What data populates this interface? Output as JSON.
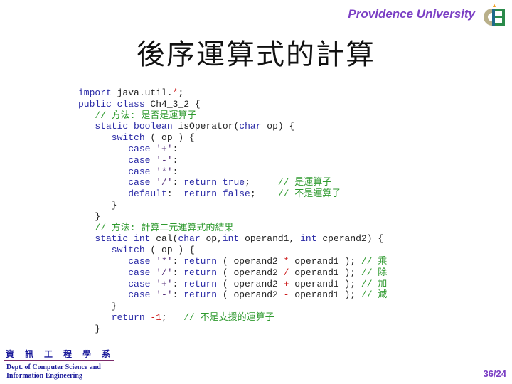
{
  "header": {
    "brand": "Providence University",
    "logo_icon": "ce-logo-icon"
  },
  "slide": {
    "title": "後序運算式的計算"
  },
  "code": {
    "lines": [
      [
        {
          "t": "import ",
          "c": "kw"
        },
        {
          "t": "java.util.",
          "c": ""
        },
        {
          "t": "*",
          "c": "op"
        },
        {
          "t": ";",
          "c": ""
        }
      ],
      [
        {
          "t": "public class ",
          "c": "kw"
        },
        {
          "t": "Ch4_3_2 {",
          "c": ""
        }
      ],
      [
        {
          "t": "   // 方法: 是否是運算子",
          "c": "cm"
        }
      ],
      [
        {
          "t": "   static boolean ",
          "c": "kw"
        },
        {
          "t": "isOperator(",
          "c": ""
        },
        {
          "t": "char ",
          "c": "kw"
        },
        {
          "t": "op) {",
          "c": ""
        }
      ],
      [
        {
          "t": "      switch ",
          "c": "kw"
        },
        {
          "t": "( op ) {",
          "c": ""
        }
      ],
      [
        {
          "t": "         case ",
          "c": "kw"
        },
        {
          "t": "'+'",
          "c": "str"
        },
        {
          "t": ":",
          "c": ""
        }
      ],
      [
        {
          "t": "         case ",
          "c": "kw"
        },
        {
          "t": "'-'",
          "c": "str"
        },
        {
          "t": ":",
          "c": ""
        }
      ],
      [
        {
          "t": "         case ",
          "c": "kw"
        },
        {
          "t": "'*'",
          "c": "str"
        },
        {
          "t": ":",
          "c": ""
        }
      ],
      [
        {
          "t": "         case ",
          "c": "kw"
        },
        {
          "t": "'/'",
          "c": "str"
        },
        {
          "t": ": ",
          "c": ""
        },
        {
          "t": "return true",
          "c": "kw"
        },
        {
          "t": ";     ",
          "c": ""
        },
        {
          "t": "// 是運算子",
          "c": "cm"
        }
      ],
      [
        {
          "t": "         default",
          "c": "kw"
        },
        {
          "t": ":  ",
          "c": ""
        },
        {
          "t": "return false",
          "c": "kw"
        },
        {
          "t": ";    ",
          "c": ""
        },
        {
          "t": "// 不是運算子",
          "c": "cm"
        }
      ],
      [
        {
          "t": "      }",
          "c": ""
        }
      ],
      [
        {
          "t": "   }",
          "c": ""
        }
      ],
      [
        {
          "t": "   // 方法: 計算二元運算式的結果",
          "c": "cm"
        }
      ],
      [
        {
          "t": "   static int ",
          "c": "kw"
        },
        {
          "t": "cal(",
          "c": ""
        },
        {
          "t": "char ",
          "c": "kw"
        },
        {
          "t": "op,",
          "c": ""
        },
        {
          "t": "int ",
          "c": "kw"
        },
        {
          "t": "operand1, ",
          "c": ""
        },
        {
          "t": "int ",
          "c": "kw"
        },
        {
          "t": "cperand2) {",
          "c": ""
        }
      ],
      [
        {
          "t": "      switch ",
          "c": "kw"
        },
        {
          "t": "( op ) {",
          "c": ""
        }
      ],
      [
        {
          "t": "         case ",
          "c": "kw"
        },
        {
          "t": "'*'",
          "c": "str"
        },
        {
          "t": ": ",
          "c": ""
        },
        {
          "t": "return ",
          "c": "kw"
        },
        {
          "t": "( operand2 ",
          "c": ""
        },
        {
          "t": "*",
          "c": "op"
        },
        {
          "t": " operand1 ); ",
          "c": ""
        },
        {
          "t": "// 乘",
          "c": "cm"
        }
      ],
      [
        {
          "t": "         case ",
          "c": "kw"
        },
        {
          "t": "'/'",
          "c": "str"
        },
        {
          "t": ": ",
          "c": ""
        },
        {
          "t": "return ",
          "c": "kw"
        },
        {
          "t": "( operand2 ",
          "c": ""
        },
        {
          "t": "/",
          "c": "op"
        },
        {
          "t": " operand1 ); ",
          "c": ""
        },
        {
          "t": "// 除",
          "c": "cm"
        }
      ],
      [
        {
          "t": "         case ",
          "c": "kw"
        },
        {
          "t": "'+'",
          "c": "str"
        },
        {
          "t": ": ",
          "c": ""
        },
        {
          "t": "return ",
          "c": "kw"
        },
        {
          "t": "( operand2 ",
          "c": ""
        },
        {
          "t": "+",
          "c": "op"
        },
        {
          "t": " operand1 ); ",
          "c": ""
        },
        {
          "t": "// 加",
          "c": "cm"
        }
      ],
      [
        {
          "t": "         case ",
          "c": "kw"
        },
        {
          "t": "'-'",
          "c": "str"
        },
        {
          "t": ": ",
          "c": ""
        },
        {
          "t": "return ",
          "c": "kw"
        },
        {
          "t": "( operand2 ",
          "c": ""
        },
        {
          "t": "-",
          "c": "op"
        },
        {
          "t": " operand1 ); ",
          "c": ""
        },
        {
          "t": "// 減",
          "c": "cm"
        }
      ],
      [
        {
          "t": "      }",
          "c": ""
        }
      ],
      [
        {
          "t": "      return ",
          "c": "kw"
        },
        {
          "t": "-1",
          "c": "op"
        },
        {
          "t": ";   ",
          "c": ""
        },
        {
          "t": "// 不是支援的運算子",
          "c": "cm"
        }
      ],
      [
        {
          "t": "   }",
          "c": ""
        }
      ]
    ]
  },
  "footer": {
    "dept_cn": "資訊工程學系",
    "dept_en_line1": "Dept. of Computer Science and",
    "dept_en_line2": "Information Engineering",
    "page": "36/24"
  },
  "colors": {
    "brand": "#7b3fc4",
    "keyword": "#2a2aa6",
    "comment": "#2f9a2f",
    "operator": "#cc1a1a",
    "dept": "#1a1a9a"
  }
}
